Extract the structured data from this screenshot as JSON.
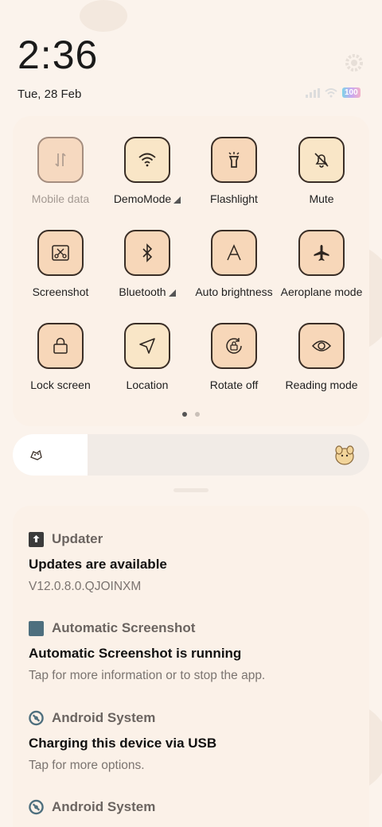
{
  "status": {
    "time": "2:36",
    "date": "Tue, 28 Feb",
    "battery": "100"
  },
  "quick_settings": {
    "tiles": [
      {
        "label": "Mobile data",
        "icon": "mobile-data-icon",
        "state": "off"
      },
      {
        "label": "DemoMode",
        "icon": "wifi-icon",
        "state": "on"
      },
      {
        "label": "Flashlight",
        "icon": "flashlight-icon",
        "state": "normal"
      },
      {
        "label": "Mute",
        "icon": "bell-off-icon",
        "state": "on"
      },
      {
        "label": "Screenshot",
        "icon": "screenshot-icon",
        "state": "normal"
      },
      {
        "label": "Bluetooth",
        "icon": "bluetooth-icon",
        "state": "normal"
      },
      {
        "label": "Auto brightness",
        "icon": "auto-brightness-icon",
        "state": "normal"
      },
      {
        "label": "Aeroplane mode",
        "icon": "airplane-icon",
        "state": "normal"
      },
      {
        "label": "Lock screen",
        "icon": "lock-icon",
        "state": "normal"
      },
      {
        "label": "Location",
        "icon": "location-icon",
        "state": "on"
      },
      {
        "label": "Rotate off",
        "icon": "rotate-lock-icon",
        "state": "normal"
      },
      {
        "label": "Reading mode",
        "icon": "eye-icon",
        "state": "normal"
      }
    ],
    "page_indicator": {
      "pages": 2,
      "current": 1
    }
  },
  "brightness": {
    "level_percent": 21
  },
  "notifications": [
    {
      "app": "Updater",
      "icon": "upload-icon",
      "title": "Updates are available",
      "text": "V12.0.8.0.QJOINXM"
    },
    {
      "app": "Automatic Screenshot",
      "icon": "app-square-icon",
      "title": "Automatic Screenshot is running",
      "text": "Tap for more information or to stop the app."
    },
    {
      "app": "Android System",
      "icon": "android-system-icon",
      "title": "Charging this device via USB",
      "text": "Tap for more options."
    },
    {
      "app": "Android System",
      "icon": "android-system-icon",
      "title": "",
      "text": ""
    }
  ],
  "colors": {
    "accent": "#f7d7b9",
    "tile_border": "#3a2e26",
    "background": "#fbf3ec"
  }
}
